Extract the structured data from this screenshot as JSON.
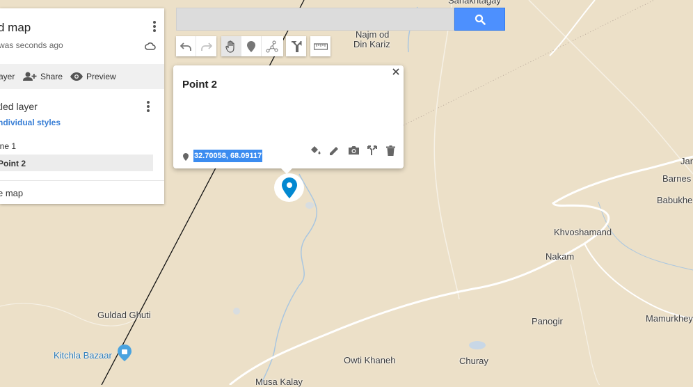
{
  "panel": {
    "title": "d map",
    "subtitle": "was seconds ago",
    "toolbar": {
      "add_layer": "ayer",
      "share": "Share",
      "preview": "Preview"
    },
    "layer_name": "tled layer",
    "styles_link": "ndividual styles",
    "items": [
      "ine 1",
      "Point 2"
    ],
    "basemap": "e map"
  },
  "search": {
    "placeholder": ""
  },
  "popup": {
    "title": "Point 2",
    "coordinates": "32.70058, 68.09117"
  },
  "places": [
    {
      "name": "Sanakhtagay"
    },
    {
      "name": "Najm od"
    },
    {
      "name": "Din Kariz"
    },
    {
      "name": "Jan"
    },
    {
      "name": "Barnes"
    },
    {
      "name": "Babukhe"
    },
    {
      "name": "Khvoshamand"
    },
    {
      "name": "Nakam"
    },
    {
      "name": "Guldad Ghuti"
    },
    {
      "name": "Kitchla Bazaar"
    },
    {
      "name": "Panogir"
    },
    {
      "name": "Mamurkhey"
    },
    {
      "name": "Owti Khaneh"
    },
    {
      "name": "Churay"
    },
    {
      "name": "Musa Kalay"
    }
  ],
  "colors": {
    "marker": "#0288d1",
    "search_button": "#4d90fe",
    "land": "#ece0c8",
    "selection": "#3b8cf0"
  },
  "icons": [
    "search-icon",
    "undo-icon",
    "redo-icon",
    "hand-icon",
    "marker-icon",
    "draw-line-icon",
    "directions-icon",
    "ruler-icon",
    "paint-bucket-icon",
    "edit-icon",
    "camera-icon",
    "directions-icon",
    "trash-icon",
    "close-icon",
    "cloud-icon",
    "more-icon",
    "add-person-icon",
    "eye-icon"
  ]
}
